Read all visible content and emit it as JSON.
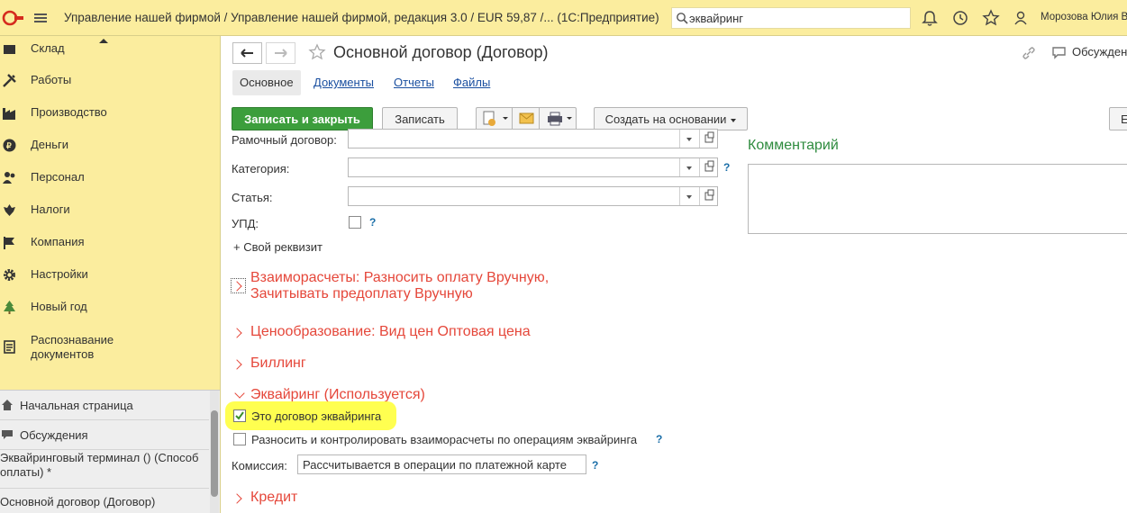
{
  "topbar": {
    "title": "Управление нашей фирмой / Управление нашей фирмой, редакция 3.0 / EUR 59,87 /...  (1С:Предприятие)",
    "search_value": "эквайринг",
    "user": "Морозова Юлия Вл",
    "icons": [
      "logo-1c",
      "menu-icon",
      "search-icon",
      "bell-icon",
      "history-icon",
      "star-icon",
      "user-icon"
    ]
  },
  "sidebar": {
    "partial_top_item": "Склад",
    "items": [
      {
        "label": "Работы",
        "icon": "tools-icon"
      },
      {
        "label": "Производство",
        "icon": "factory-icon"
      },
      {
        "label": "Деньги",
        "icon": "money-icon"
      },
      {
        "label": "Персонал",
        "icon": "people-icon"
      },
      {
        "label": "Налоги",
        "icon": "emblem-icon"
      },
      {
        "label": "Компания",
        "icon": "flag-icon"
      },
      {
        "label": "Настройки",
        "icon": "gear-icon"
      },
      {
        "label": "Новый год",
        "icon": "tree-icon"
      },
      {
        "label": "Распознавание документов",
        "icon": "scan-icon"
      }
    ],
    "lower": {
      "home": "Начальная страница",
      "discussions": "Обсуждения",
      "open_windows": [
        "Эквайринговый терминал  () (Способ оплаты) *",
        "Основной договор (Договор)"
      ]
    }
  },
  "document": {
    "title": "Основной договор (Договор)",
    "discuss": "Обсужден",
    "tabs": [
      {
        "label": "Основное",
        "active": true
      },
      {
        "label": "Документы",
        "active": false
      },
      {
        "label": "Отчеты",
        "active": false
      },
      {
        "label": "Файлы",
        "active": false
      }
    ],
    "toolbar": {
      "save_close": "Записать и закрыть",
      "save": "Записать",
      "create_based": "Создать на основании",
      "more": "Е"
    },
    "fields": {
      "frame_contract_label": "Рамочный договор:",
      "category_label": "Категория:",
      "category_value": "",
      "article_label": "Статья:",
      "article_value": "",
      "upd_label": "УПД:",
      "own_attr": "+ Свой реквизит"
    },
    "comment_title": "Комментарий",
    "sections": {
      "settlements_line1": "Взаиморасчеты: Разносить оплату Вручную,",
      "settlements_line2": "Зачитывать предоплату Вручную",
      "pricing": "Ценообразование: Вид цен Оптовая цена",
      "billing": "Биллинг",
      "acquiring": "Эквайринг (Используется)",
      "credit": "Кредит"
    },
    "acquiring": {
      "is_acquiring_label": "Это договор эквайринга",
      "is_acquiring_checked": true,
      "distribute_label": "Разносить и контролировать взаиморасчеты по операциям эквайринга",
      "distribute_checked": false,
      "commission_label": "Комиссия:",
      "commission_value": "Рассчитывается в операции по платежной карте"
    },
    "help_mark": "?",
    "highlight_color": "#ffff3d",
    "accent_green": "#3c9e3c",
    "section_red": "#e5473a"
  }
}
